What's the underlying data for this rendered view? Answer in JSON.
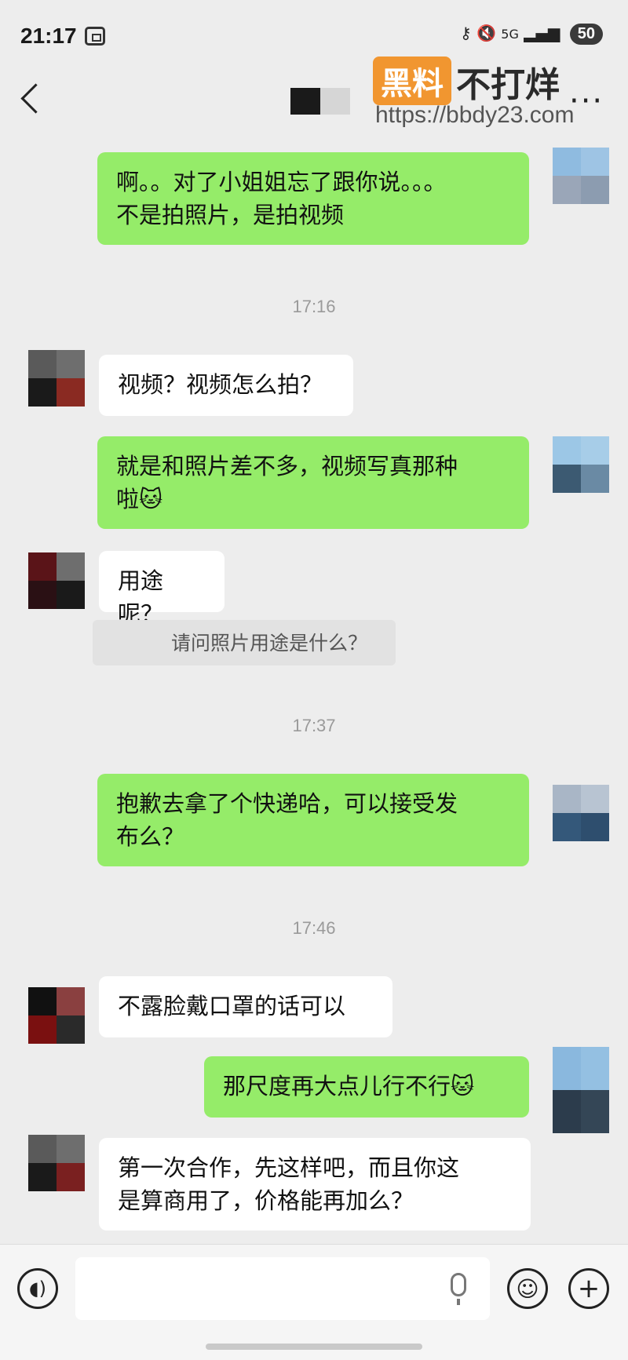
{
  "status_bar": {
    "time": "21:17",
    "network": "5G",
    "battery": "50"
  },
  "header": {
    "more_label": "···"
  },
  "watermark": {
    "badge": "黑料",
    "text": "不打烊",
    "url": "https://bbdy23.com"
  },
  "messages": [
    {
      "side": "me",
      "lines": [
        "啊。。对了小姐姐忘了跟你说。。。",
        "不是拍照片，是拍视频"
      ]
    },
    {
      "side": "time",
      "text": "17:16"
    },
    {
      "side": "them",
      "lines": [
        "视频？视频怎么拍？"
      ]
    },
    {
      "side": "me",
      "lines": [
        "就是和照片差不多，视频写真那种",
        "啦🐱"
      ]
    },
    {
      "side": "them",
      "lines": [
        "用途呢？"
      ],
      "quote": "请问照片用途是什么？"
    },
    {
      "side": "time",
      "text": "17:37"
    },
    {
      "side": "me",
      "lines": [
        "抱歉去拿了个快递哈，可以接受发",
        "布么？"
      ]
    },
    {
      "side": "time",
      "text": "17:46"
    },
    {
      "side": "them",
      "lines": [
        "不露脸戴口罩的话可以"
      ]
    },
    {
      "side": "me",
      "lines": [
        "那尺度再大点儿行不行🐱"
      ]
    },
    {
      "side": "them",
      "lines": [
        "第一次合作，先这样吧，而且你这",
        "是算商用了，价格能再加么？"
      ]
    }
  ],
  "input_bar": {
    "voice_icon": "voice-icon",
    "emoji_icon": "emoji-icon",
    "plus_icon": "plus-icon",
    "mic_icon": "mic-icon"
  },
  "colors": {
    "me_bubble": "#95ec69",
    "them_bubble": "#ffffff",
    "background": "#ededed"
  }
}
